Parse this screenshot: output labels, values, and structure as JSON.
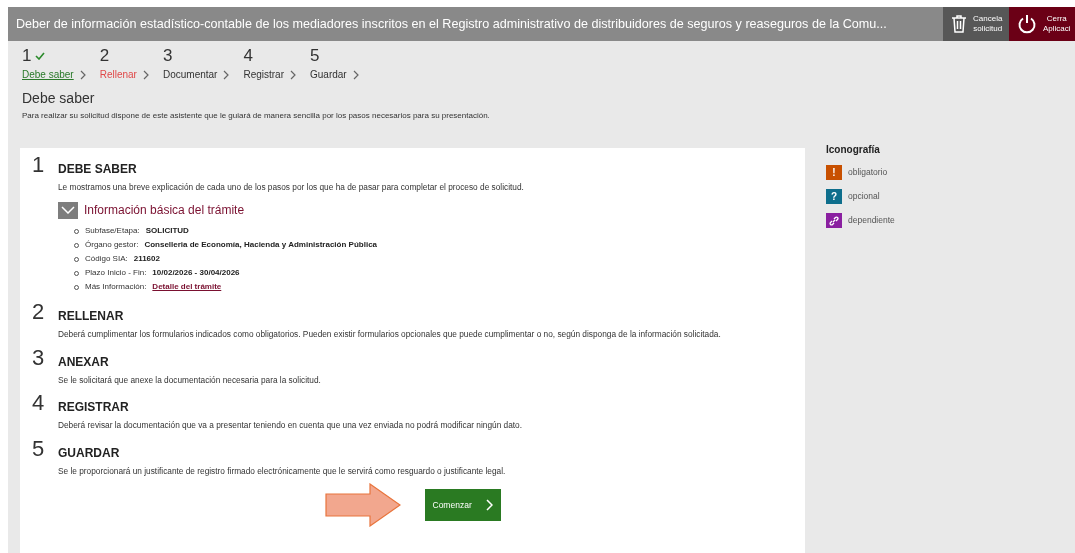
{
  "header": {
    "title": "Deber de información estadístico-contable de los mediadores inscritos en el Registro administrativo de distribuidores de seguros y reaseguros de la Comu...",
    "buttons": [
      {
        "kind": "cancel",
        "lines": [
          "Cancela",
          "solicitud"
        ]
      },
      {
        "kind": "close",
        "lines": [
          "Cerra",
          "Aplicaci"
        ]
      }
    ]
  },
  "steps": [
    {
      "number": "1",
      "label": "Debe saber",
      "completed": true,
      "selected": false
    },
    {
      "number": "2",
      "label": "Rellenar",
      "completed": false,
      "selected": true
    },
    {
      "number": "3",
      "label": "Documentar",
      "completed": false,
      "selected": false
    },
    {
      "number": "4",
      "label": "Registrar",
      "completed": false,
      "selected": false
    },
    {
      "number": "5",
      "label": "Guardar",
      "completed": false,
      "selected": false
    }
  ],
  "page": {
    "title": "Debe saber",
    "intro": "Para realizar su solicitud dispone de este asistente que le guiará de manera sencilla por los pasos necesarios para su presentación."
  },
  "sections": [
    {
      "number": "1",
      "title": "DEBE SABER",
      "text": "Le mostramos una breve explicación de cada uno de los pasos por los que ha de pasar para completar el proceso de solicitud.",
      "info": {
        "title": "Información básica del trámite",
        "expanded": true,
        "items": [
          {
            "label": "Subfase/Etapa:",
            "value": "SOLICITUD",
            "kind": "text"
          },
          {
            "label": "Órgano gestor:",
            "value": "Conselleria de Economía, Hacienda y Administración Pública",
            "kind": "text"
          },
          {
            "label": "Código SIA:",
            "value": "211602",
            "kind": "text"
          },
          {
            "label": "Plazo Inicio - Fin:",
            "value": "10/02/2026 - 30/04/2026",
            "kind": "text"
          },
          {
            "label": "Más Información:",
            "value": "Detalle del trámite",
            "kind": "link"
          }
        ]
      }
    },
    {
      "number": "2",
      "title": "RELLENAR",
      "text": "Deberá cumplimentar los formularios indicados como obligatorios. Pueden existir formularios opcionales que puede cumplimentar o no, según disponga de la información solicitada."
    },
    {
      "number": "3",
      "title": "ANEXAR",
      "text": "Se le solicitará que anexe la documentación necesaria para la solicitud."
    },
    {
      "number": "4",
      "title": "REGISTRAR",
      "text": "Deberá revisar la documentación que va a presentar teniendo en cuenta que una vez enviada no podrá modificar ningún dato."
    },
    {
      "number": "5",
      "title": "GUARDAR",
      "text": "Se le proporcionará un justificante de registro firmado electrónicamente que le servirá como resguardo o justificante legal."
    }
  ],
  "start_button": {
    "label": "Comenzar"
  },
  "legend": {
    "title": "Iconografía",
    "items": [
      {
        "kind": "char",
        "symbol": "!",
        "label": "obligatorio",
        "color": "#c85000"
      },
      {
        "kind": "char",
        "symbol": "?",
        "label": "opcional",
        "color": "#0e6e8c"
      },
      {
        "kind": "link",
        "label": "dependiente",
        "color": "#8a1fa0"
      }
    ]
  }
}
